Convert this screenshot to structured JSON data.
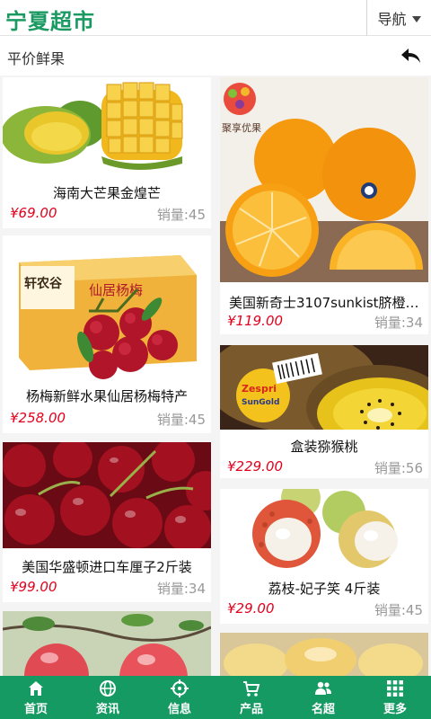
{
  "header": {
    "logo": "宁夏超市",
    "nav_label": "导航"
  },
  "section": {
    "title": "平价鲜果"
  },
  "products": [
    {
      "name": "海南大芒果金煌芒",
      "price": "¥69.00",
      "sales": "销量:45"
    },
    {
      "name": "美国新奇士3107sunkist脐橙…",
      "price": "¥119.00",
      "sales": "销量:34"
    },
    {
      "name": "杨梅新鲜水果仙居杨梅特产",
      "price": "¥258.00",
      "sales": "销量:45"
    },
    {
      "name": "盒装猕猴桃",
      "price": "¥229.00",
      "sales": "销量:56"
    },
    {
      "name": "美国华盛顿进口车厘子2斤装",
      "price": "¥99.00",
      "sales": "销量:34"
    },
    {
      "name": "荔枝-妃子笑 4斤装",
      "price": "¥29.00",
      "sales": "销量:45"
    }
  ],
  "image_text": {
    "orange_brand": "聚享优果",
    "box_brand": "轩农谷",
    "box_label": "仙居杨梅",
    "kiwi_brand": "Zespri",
    "kiwi_label": "SunGold"
  },
  "bottom_nav": [
    {
      "label": "首页",
      "icon": "home-icon"
    },
    {
      "label": "资讯",
      "icon": "globe-icon"
    },
    {
      "label": "信息",
      "icon": "target-icon"
    },
    {
      "label": "产品",
      "icon": "cart-icon"
    },
    {
      "label": "名超",
      "icon": "users-icon"
    },
    {
      "label": "更多",
      "icon": "grid-icon"
    }
  ],
  "colors": {
    "brand_green": "#169a64",
    "price_red": "#e4001c",
    "sales_gray": "#999999"
  }
}
